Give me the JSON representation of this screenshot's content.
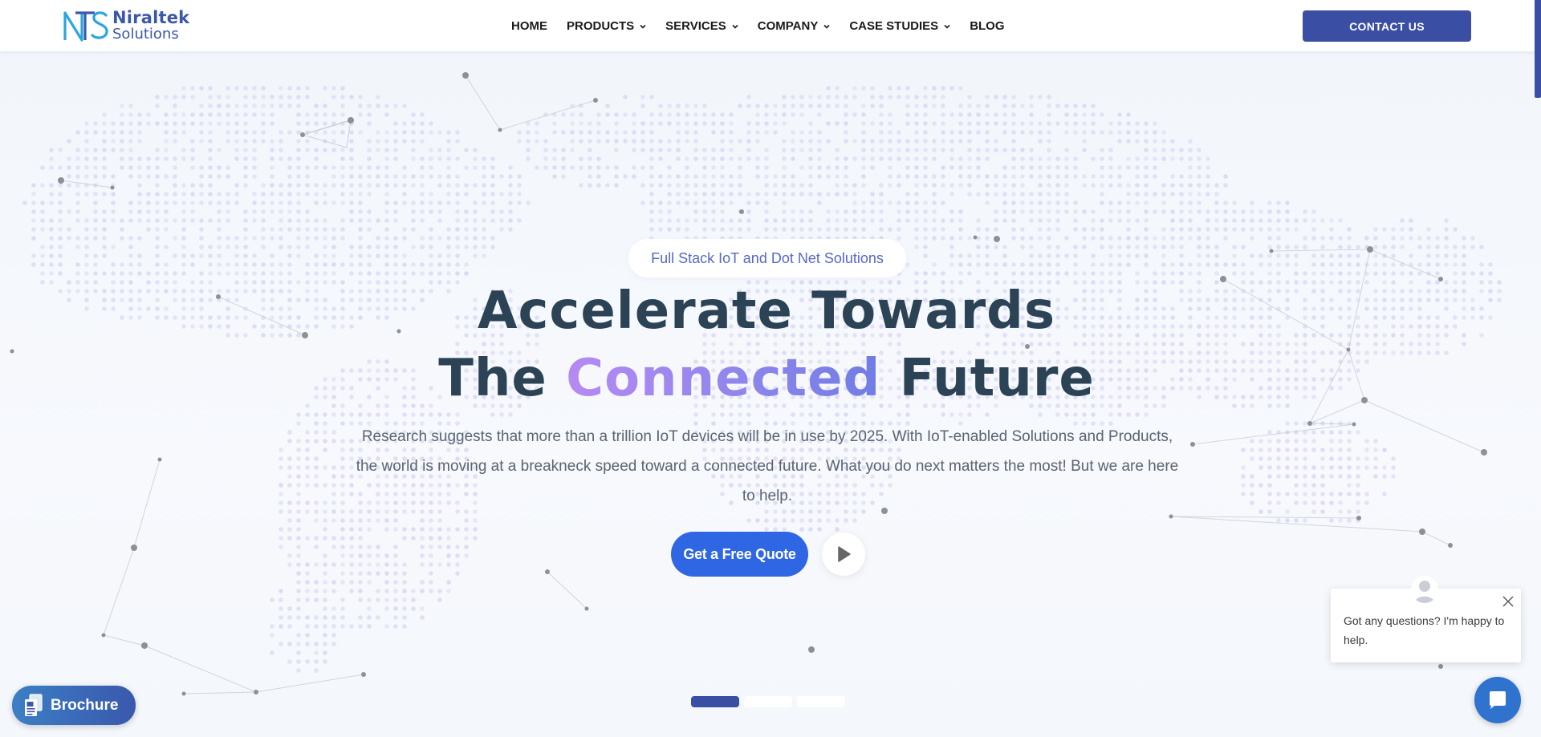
{
  "brand": {
    "name": "Niraltek",
    "subtitle": "Solutions",
    "logo_icon": "nts-monogram-icon",
    "color": "#3b57a8"
  },
  "nav": {
    "items": [
      {
        "label": "HOME",
        "has_dropdown": false
      },
      {
        "label": "PRODUCTS",
        "has_dropdown": true
      },
      {
        "label": "SERVICES",
        "has_dropdown": true
      },
      {
        "label": "COMPANY",
        "has_dropdown": true
      },
      {
        "label": "CASE STUDIES",
        "has_dropdown": true
      },
      {
        "label": "BLOG",
        "has_dropdown": false
      }
    ],
    "contact_label": "CONTACT US"
  },
  "hero": {
    "tagline": "Full Stack IoT and Dot Net Solutions",
    "headline_line1": "Accelerate Towards",
    "headline_line2_pre": "The ",
    "headline_line2_highlight": "Connected",
    "headline_line2_post": " Future",
    "description": "Research suggests that more than a trillion IoT devices will be in use by 2025. With IoT-enabled Solutions and Products, the world is moving at a breakneck speed toward a connected future. What you do next matters the most! But we are here to help.",
    "cta_label": "Get a Free Quote",
    "play_icon": "play-icon",
    "slides": [
      {
        "active": true
      },
      {
        "active": false
      },
      {
        "active": false
      }
    ]
  },
  "brochure": {
    "label": "Brochure",
    "icon": "brochure-document-icon"
  },
  "chat": {
    "message": "Got any questions? I'm happy to help.",
    "avatar_icon": "user-avatar-icon",
    "close_icon": "close-icon",
    "launcher_icon": "chat-bubble-icon"
  },
  "colors": {
    "primary": "#3a4fa4",
    "cta": "#2e66e3",
    "headline": "#2b4355",
    "highlight_start": "#b68af2",
    "highlight_end": "#6f7de4",
    "tagline": "#5668c4"
  }
}
